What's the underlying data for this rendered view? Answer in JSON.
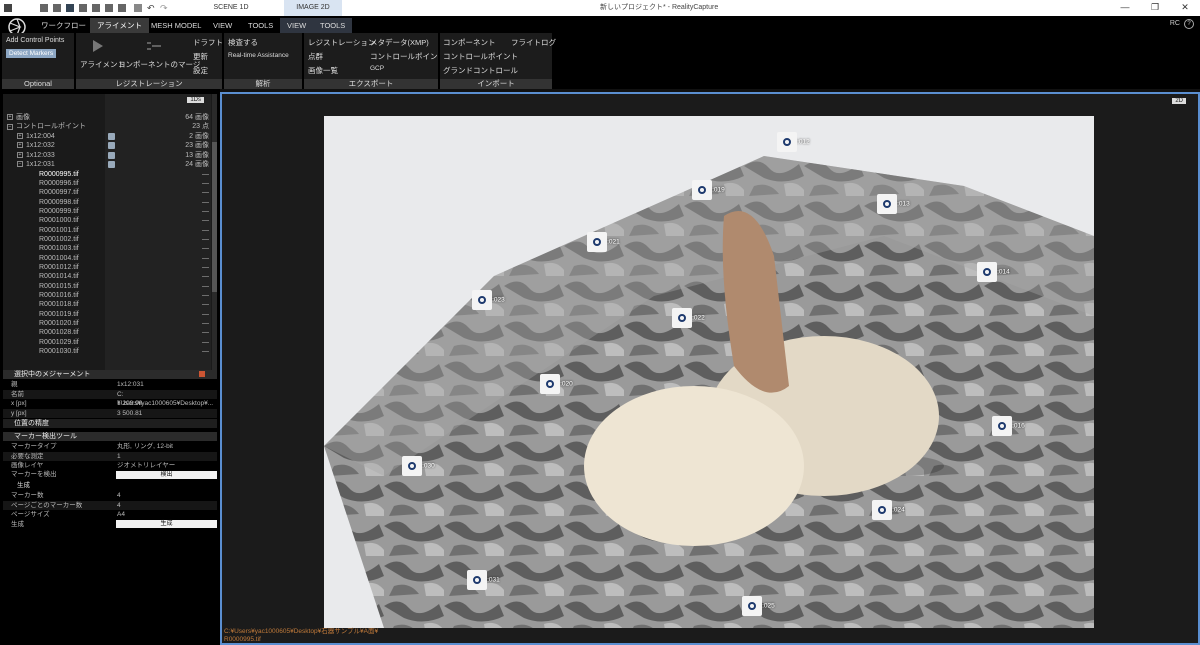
{
  "titlebar": {
    "tabs": [
      "SCENE 1D",
      "IMAGE 2D"
    ],
    "window_title": "新しいプロジェクト* - RealityCapture",
    "min": "—",
    "max": "❐",
    "close": "✕"
  },
  "ribbon_tabs": {
    "workflow": "ワークフロー",
    "alignment": "アライメント",
    "mesh_model": "MESH MODEL",
    "view": "VIEW",
    "tools": "TOOLS",
    "view2": "VIEW",
    "tools2": "TOOLS",
    "rc": "RC",
    "help": "?"
  },
  "ribbon": {
    "optional": {
      "add_cp": "Add Control Points",
      "detect": "Detect Markers",
      "title": "Optional"
    },
    "registration": {
      "align": "アライメント",
      "merge": "コンポーネントのマージ",
      "draft": "ドラフト",
      "update": "更新",
      "settings": "設定",
      "title": "レジストレーション"
    },
    "analysis": {
      "inspect": "検査する",
      "rta": "Real-time Assistance",
      "title": "解析"
    },
    "export": {
      "reg": "レジストレーション",
      "pointcloud": "点群",
      "imagelist": "画像一覧",
      "metadata": "メタデータ(XMP)",
      "cp": "コントロールポイント",
      "gcp": "GCP",
      "title": "エクスポート"
    },
    "import": {
      "component": "コンポーネント",
      "cp": "コントロールポイント",
      "groundcontrol": "グランドコントロール",
      "flightlog": "フライトログ",
      "title": "インポート"
    }
  },
  "tree": {
    "btn": "1Ds",
    "rows": [
      {
        "label": "画像",
        "value": "64 画像",
        "exp": "+"
      },
      {
        "label": "コントロールポイント",
        "value": "23 点",
        "exp": "−"
      },
      {
        "label": "1x12:004",
        "value": "2 画像",
        "exp": "+"
      },
      {
        "label": "1x12:032",
        "value": "23 画像",
        "exp": "+"
      },
      {
        "label": "1x12:033",
        "value": "13 画像",
        "exp": "+"
      },
      {
        "label": "1x12:031",
        "value": "24 画像",
        "exp": "−"
      }
    ],
    "files": [
      "R0000995.tif",
      "R0000996.tif",
      "R0000997.tif",
      "R0000998.tif",
      "R0000999.tif",
      "R0001000.tif",
      "R0001001.tif",
      "R0001002.tif",
      "R0001003.tif",
      "R0001004.tif",
      "R0001012.tif",
      "R0001014.tif",
      "R0001015.tif",
      "R0001016.tif",
      "R0001018.tif",
      "R0001019.tif",
      "R0001020.tif",
      "R0001028.tif",
      "R0001029.tif",
      "R0001030.tif"
    ],
    "dash": "—"
  },
  "measure": {
    "title": "選択中のメジャーメント",
    "rows": [
      {
        "k": "親",
        "v": "1x12:031"
      },
      {
        "k": "名前",
        "v": "C:¥Users¥yac1000605¥Desktop¥..."
      },
      {
        "k": "x [px]",
        "v": "1 209.98"
      },
      {
        "k": "y [px]",
        "v": "3 500.81"
      }
    ],
    "sub": "位置の精度"
  },
  "detector": {
    "title": "マーカー検出ツール",
    "rows": [
      {
        "k": "マーカータイプ",
        "v": "丸形, リング, 12-bit"
      },
      {
        "k": "必要な測定",
        "v": "1"
      },
      {
        "k": "画像レイヤ",
        "v": "ジオメトリレイヤー"
      }
    ],
    "detect_label": "マーカーを検出",
    "detect_btn": "検出",
    "gen_section": "生成",
    "gen_rows": [
      {
        "k": "マーカー数",
        "v": "4"
      },
      {
        "k": "ページごとのマーカー数",
        "v": "4"
      },
      {
        "k": "ページサイズ",
        "v": "A4"
      }
    ],
    "gen_label": "生成",
    "gen_btn": "生成"
  },
  "viewport": {
    "btn": "2D",
    "path": "C:¥Users¥yac1000605¥Desktop¥石器サンプル¥A面¥",
    "file": "R0000995.tif",
    "markers": [
      "1x12:012",
      "1x12:019",
      "1x12:013",
      "1x12:021",
      "1x12:014",
      "1x12:023",
      "1x12:022",
      "1x12:020",
      "1x12:016",
      "1x12:030",
      "1x12:024",
      "1x12:031",
      "1x12:025"
    ]
  }
}
